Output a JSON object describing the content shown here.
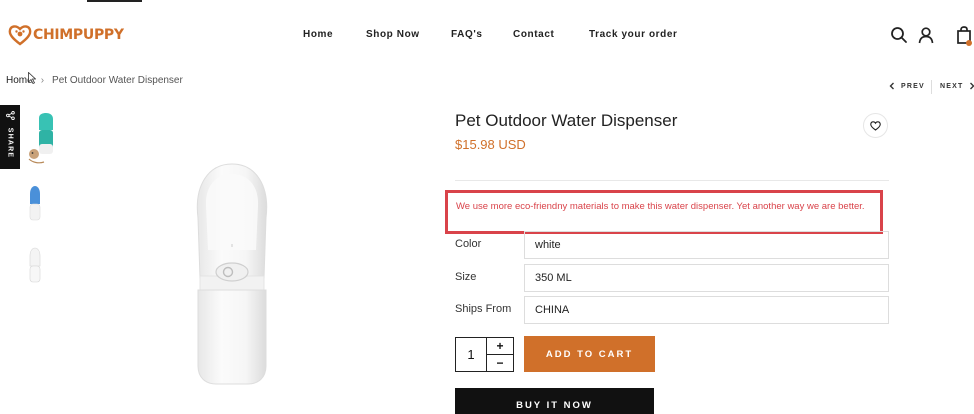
{
  "brand": {
    "name": "CHIMPUPPY",
    "color": "#d0702a"
  },
  "nav": {
    "items": [
      {
        "label": "Home"
      },
      {
        "label": "Shop Now"
      },
      {
        "label": "FAQ's"
      },
      {
        "label": "Contact"
      },
      {
        "label": "Track your order"
      }
    ]
  },
  "header_icons": [
    "search-icon",
    "account-icon",
    "cart-icon"
  ],
  "breadcrumb": {
    "home": "Home",
    "separator": "›",
    "current": "Pet Outdoor Water Dispenser"
  },
  "pager": {
    "prev": "PREV",
    "next": "NEXT"
  },
  "share": {
    "label": "SHARE"
  },
  "product": {
    "title": "Pet Outdoor Water Dispenser",
    "price": "$15.98 USD",
    "description": "We use more eco-friendny materials to make this water dispenser. Yet another way we are better.",
    "options": [
      {
        "label": "Color",
        "value": "white"
      },
      {
        "label": "Size",
        "value": "350 ML"
      },
      {
        "label": "Ships From",
        "value": "CHINA"
      }
    ],
    "quantity": "1",
    "qty_plus": "+",
    "qty_minus": "−",
    "add_to_cart": "ADD TO CART",
    "buy_now": "BUY IT NOW"
  },
  "colors": {
    "accent": "#d0702a",
    "highlight_border": "#d9434a",
    "dark_button": "#111111"
  }
}
